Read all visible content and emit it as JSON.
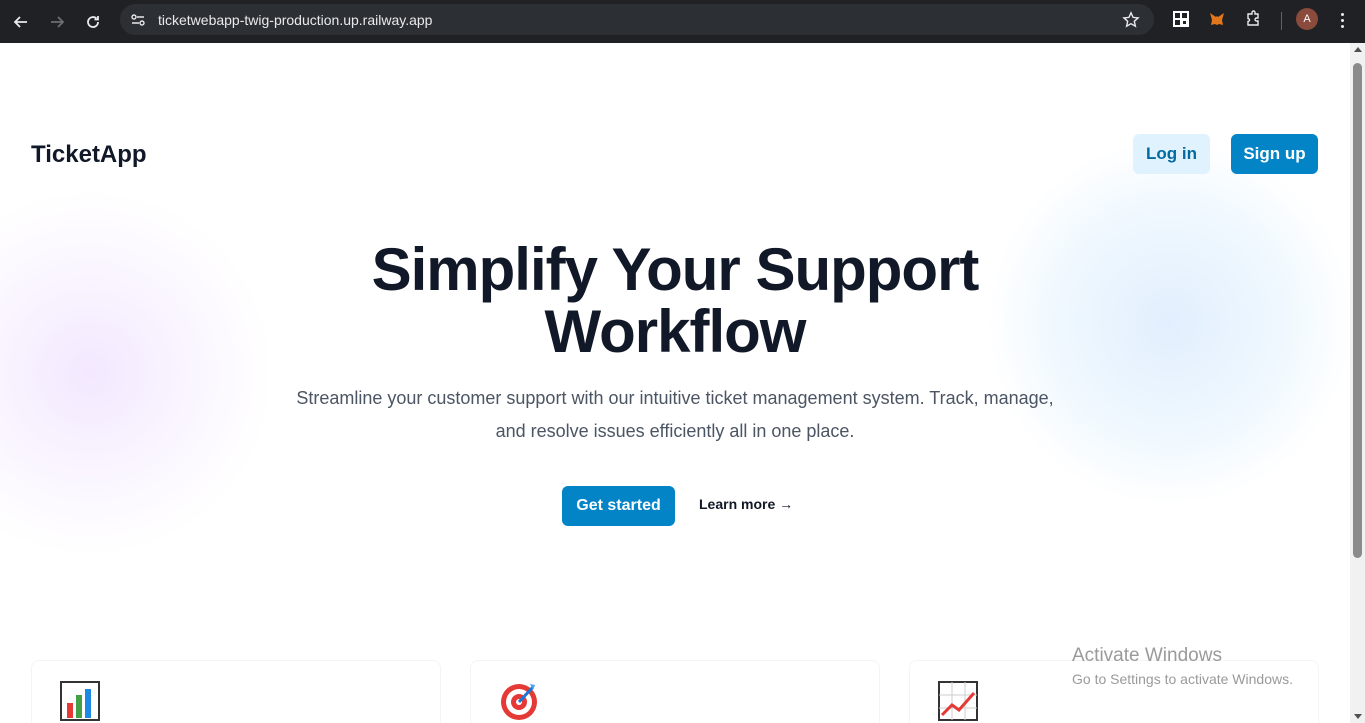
{
  "browser": {
    "url": "ticketwebapp-twig-production.up.railway.app",
    "profile_initial": "A",
    "icons": [
      "back-icon",
      "forward-icon",
      "reload-icon",
      "site-info-icon",
      "bookmark-star-icon",
      "qr-code-icon",
      "metamask-icon",
      "extensions-icon",
      "menu-icon"
    ]
  },
  "header": {
    "logo": "TicketApp",
    "login_label": "Log in",
    "signup_label": "Sign up"
  },
  "hero": {
    "title_line1": "Simplify Your Support",
    "title_line2": "Workflow",
    "subtitle_line1": "Streamline your customer support with our intuitive ticket management system. Track, manage,",
    "subtitle_line2": "and resolve issues efficiently all in one place.",
    "cta_primary": "Get started",
    "cta_secondary": "Learn more →"
  },
  "features": {
    "icons": [
      "bar-chart-icon",
      "target-icon",
      "trend-chart-icon"
    ]
  },
  "watermark": {
    "title": "Activate Windows",
    "subtitle": "Go to Settings to activate Windows."
  },
  "colors": {
    "primary": "#0284c7",
    "primary_light": "#e0f2fe",
    "heading": "#111827",
    "body_text": "#4b5563",
    "chrome_bg": "#202124"
  }
}
